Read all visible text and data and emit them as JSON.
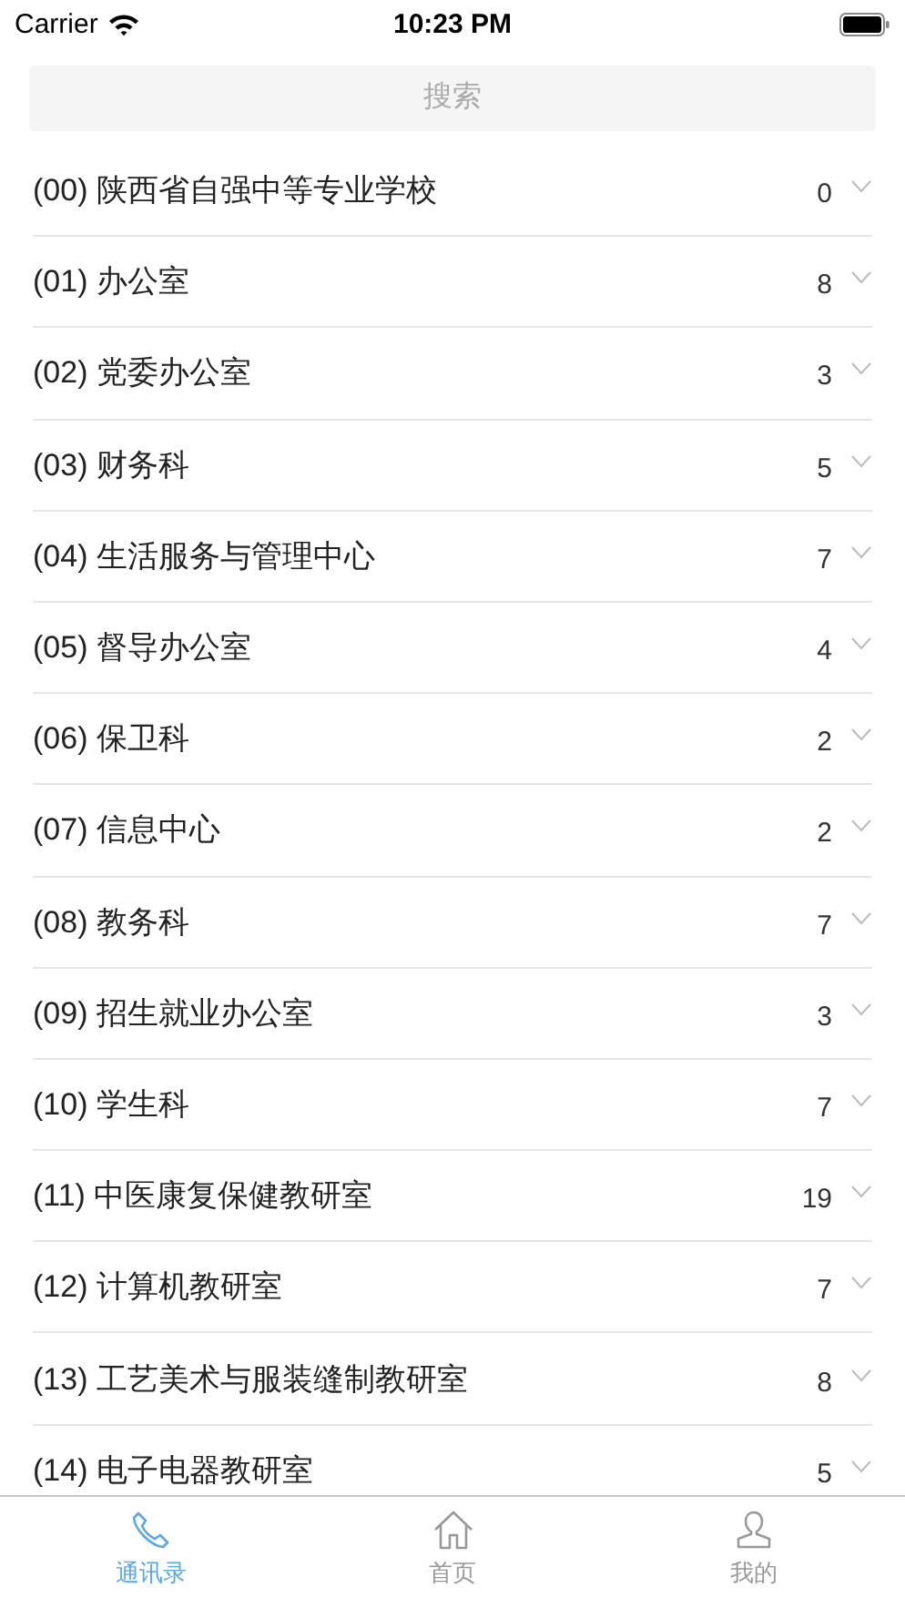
{
  "status_bar": {
    "carrier": "Carrier",
    "time": "10:23 PM"
  },
  "search": {
    "placeholder": "搜索"
  },
  "groups": [
    {
      "label": "(00) 陕西省自强中等专业学校",
      "count": "0",
      "expanded": false
    },
    {
      "label": "(01) 办公室",
      "count": "8",
      "expanded": false
    },
    {
      "label": "(02) 党委办公室",
      "count": "3",
      "expanded": false
    },
    {
      "label": "(03) 财务科",
      "count": "5",
      "expanded": false
    },
    {
      "label": "(04) 生活服务与管理中心",
      "count": "7",
      "expanded": false
    },
    {
      "label": "(05) 督导办公室",
      "count": "4",
      "expanded": false
    },
    {
      "label": "(06) 保卫科",
      "count": "2",
      "expanded": false
    },
    {
      "label": "(07) 信息中心",
      "count": "2",
      "expanded": false
    },
    {
      "label": "(08) 教务科",
      "count": "7",
      "expanded": false
    },
    {
      "label": "(09) 招生就业办公室",
      "count": "3",
      "expanded": false
    },
    {
      "label": "(10) 学生科",
      "count": "7",
      "expanded": false
    },
    {
      "label": "(11) 中医康复保健教研室",
      "count": "19",
      "expanded": false
    },
    {
      "label": "(12) 计算机教研室",
      "count": "7",
      "expanded": false
    },
    {
      "label": "(13) 工艺美术与服装缝制教研室",
      "count": "8",
      "expanded": false
    },
    {
      "label": "(14) 电子电器教研室",
      "count": "5",
      "expanded": false
    }
  ],
  "tab_bar": [
    {
      "label": "通讯录",
      "kind": "phone",
      "selected": true
    },
    {
      "label": "首页",
      "kind": "home",
      "selected": false
    },
    {
      "label": "我的",
      "kind": "person",
      "selected": false
    }
  ]
}
